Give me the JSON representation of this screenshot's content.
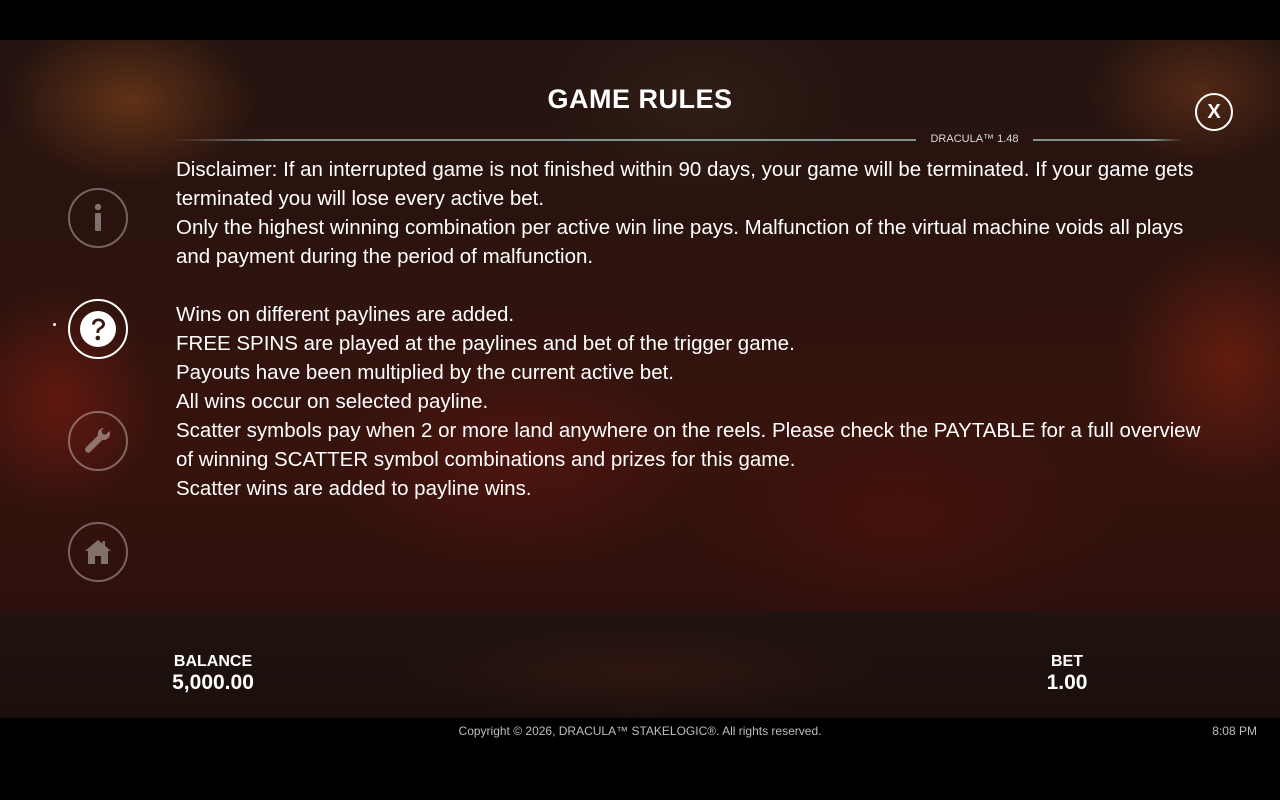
{
  "header": {
    "title": "GAME RULES",
    "close_label": "X",
    "version": "DRACULA™ 1.48"
  },
  "rules": {
    "paragraph_1": "Disclaimer: If an interrupted game is not finished within 90 days, your game will be terminated. If your game gets terminated you will lose every active bet.",
    "paragraph_2": "Only the highest winning combination per active win line pays. Malfunction of the virtual machine voids all plays and payment during the period of malfunction.",
    "line_1": "Wins on different paylines are added.",
    "line_2": "FREE SPINS are played at the paylines and bet of the trigger game.",
    "line_3": "Payouts have been multiplied by the current active bet.",
    "line_4": "All wins occur on selected payline.",
    "line_5": "Scatter symbols pay when 2 or more land anywhere on the reels. Please check the PAYTABLE for a full overview of winning SCATTER symbol combinations and prizes for this game.",
    "line_6": "Scatter wins are added to payline wins."
  },
  "sidebar": {
    "items": [
      {
        "icon": "info-icon",
        "active": false
      },
      {
        "icon": "question-icon",
        "active": true
      },
      {
        "icon": "wrench-icon",
        "active": false
      },
      {
        "icon": "home-icon",
        "active": false
      }
    ]
  },
  "status": {
    "balance_label": "BALANCE",
    "balance_value": "5,000.00",
    "bet_label": "BET",
    "bet_value": "1.00"
  },
  "footer": {
    "copyright": "Copyright © 2026, DRACULA™ STAKELOGIC®. All rights reserved.",
    "time": "8:08 PM"
  },
  "colors": {
    "text": "#ffffff",
    "divider": "#96b4b4",
    "panel": "#1a0f0c"
  }
}
